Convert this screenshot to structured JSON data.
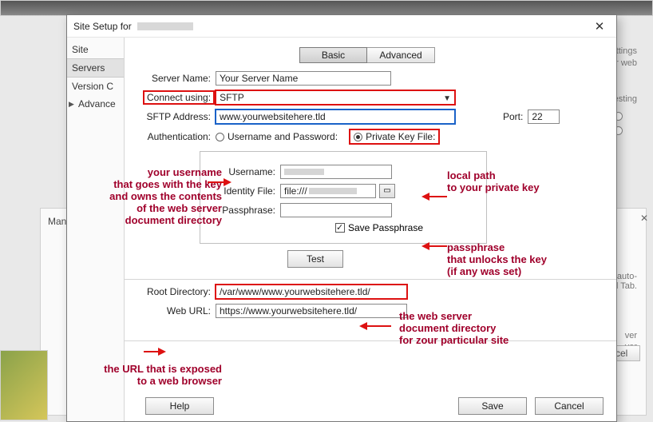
{
  "bg": {
    "mana": "Mana",
    "settings1": "ettings",
    "settings2": "r web",
    "testing": "Testing",
    "auto1": "e the auto-",
    "auto2": "nced Tab.",
    "ver": "ver",
    "ver2": "ver",
    "cancel": "ancel"
  },
  "dialog": {
    "title_prefix": "Site Setup for",
    "close": "✕"
  },
  "sidebar": {
    "items": [
      {
        "label": "Site"
      },
      {
        "label": "Servers"
      },
      {
        "label": "Version C"
      },
      {
        "label": "Advance"
      }
    ]
  },
  "tabs": {
    "basic": "Basic",
    "advanced": "Advanced"
  },
  "form": {
    "server_name_label": "Server Name:",
    "server_name_value": "Your Server Name",
    "connect_label": "Connect using:",
    "connect_value": "SFTP",
    "addr_label": "SFTP Address:",
    "addr_value": "www.yourwebsitehere.tld",
    "port_label": "Port:",
    "port_value": "22",
    "auth_label": "Authentication:",
    "auth_opt1": "Username and Password:",
    "auth_opt2": "Private Key File:",
    "username_label": "Username:",
    "identity_label": "Identity File:",
    "identity_value": "file:///",
    "passphrase_label": "Passphrase:",
    "save_pass": "Save Passphrase",
    "test": "Test",
    "root_label": "Root Directory:",
    "root_value": "/var/www/www.yourwebsitehere.tld/",
    "url_label": "Web URL:",
    "url_value": "https://www.yourwebsitehere.tld/",
    "help": "Help",
    "save": "Save",
    "cancel": "Cancel"
  },
  "anno": {
    "left1": "your username\nthat goes with the key\nand owns the contents\nof the web server\ndocument directory",
    "right1": "local path\nto your private key",
    "right2": "passphrase\nthat unlocks the key\n(if any was set)",
    "right3": "the web server\ndocument directory\nfor zour particular site",
    "left2": "the URL that is exposed\nto a web browser"
  }
}
